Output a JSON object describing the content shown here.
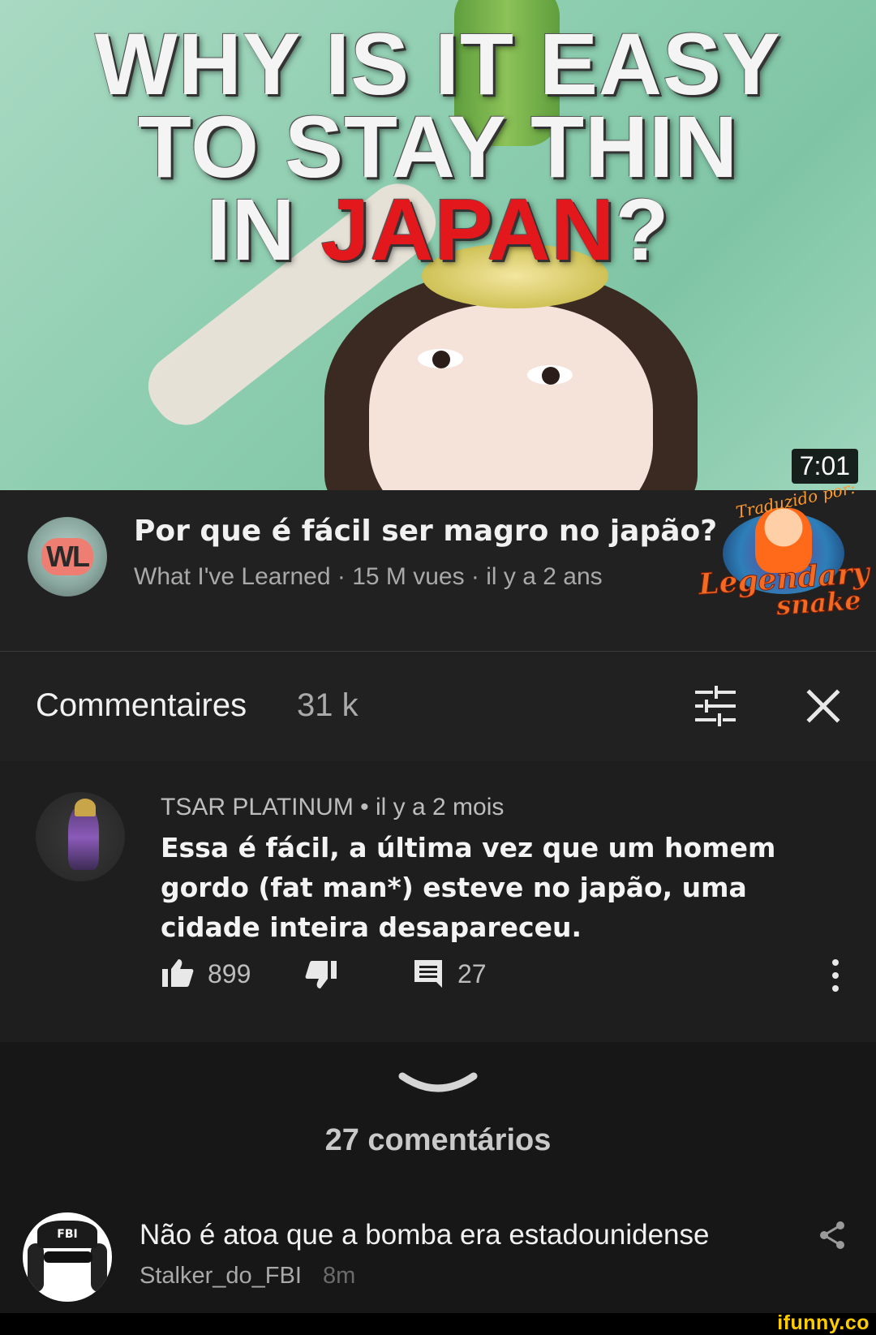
{
  "thumbnail": {
    "headline_line1": "WHY IS IT EASY",
    "headline_line2": "TO STAY THIN",
    "headline_line3_white": "IN ",
    "headline_line3_red": "JAPAN",
    "headline_line3_q": "?",
    "duration": "7:01",
    "accent_red": "#e3181d"
  },
  "video": {
    "channel_avatar_text": "WL",
    "title": "Por que é fácil ser magro no japão?",
    "meta": "What I've Learned · 15 M vues · il y a 2 ans",
    "watermark_tag": "Traduzido por:",
    "watermark_line1": "Legendary",
    "watermark_line2": "snake"
  },
  "comments_header": {
    "title": "Commentaires",
    "count": "31 k",
    "filter_icon": "sort-filter-icon",
    "close_icon": "close-icon"
  },
  "top_comment": {
    "author_line": "TSAR PLATINUM • il y a 2 mois",
    "text": "Essa é fácil, a última vez que um homem gordo (fat man*) esteve no japão, uma cidade inteira desapareceu.",
    "likes": "899",
    "replies": "27"
  },
  "replies_section": {
    "count_label": "27 comentários",
    "reply": {
      "avatar_cap_text": "FBI",
      "text": "Não é atoa que a bomba era estadounidense",
      "user": "Stalker_do_FBI",
      "time": "8m"
    }
  },
  "footer": {
    "brand": "ifunny.co",
    "brand_color": "#ffcc00"
  }
}
